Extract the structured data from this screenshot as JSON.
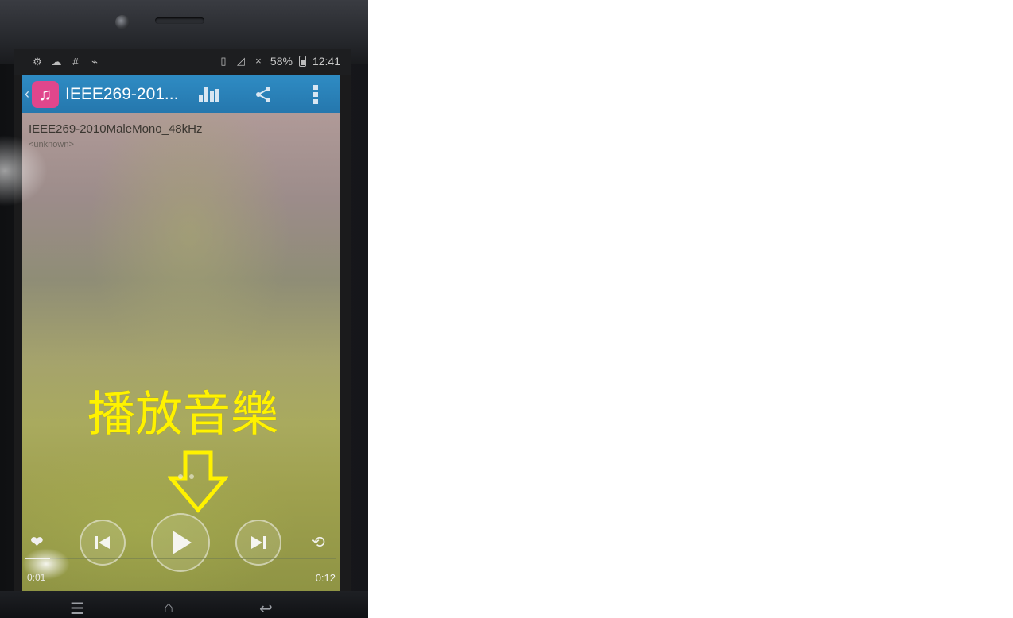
{
  "status_bar": {
    "battery": "58%",
    "time": "12:41"
  },
  "action_bar": {
    "title": "IEEE269-201..."
  },
  "track": {
    "title": "IEEE269-2010MaleMono_48kHz",
    "artist": "<unknown>"
  },
  "overlay": {
    "caption": "播放音樂"
  },
  "player": {
    "elapsed": "0:01",
    "duration": "0:12",
    "progress_fraction": 0.08
  },
  "colors": {
    "action_bar": "#2a82bb",
    "app_icon": "#e0468c",
    "caption": "#fff200"
  }
}
